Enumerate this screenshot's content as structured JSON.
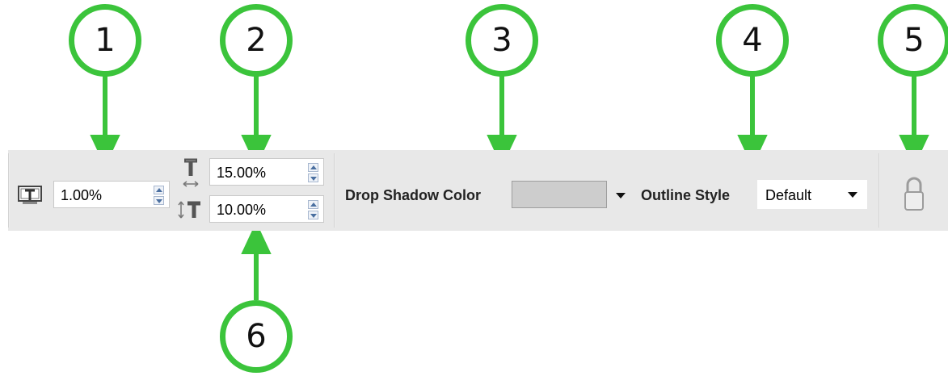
{
  "callouts": [
    "1",
    "2",
    "3",
    "4",
    "5",
    "6"
  ],
  "toolbar": {
    "first_field": {
      "value": "1.00%"
    },
    "second_field_top": {
      "value": "15.00%"
    },
    "second_field_bottom": {
      "value": "10.00%"
    },
    "drop_shadow": {
      "label": "Drop Shadow Color",
      "color": "#cdcdcd"
    },
    "outline_style": {
      "label": "Outline Style",
      "value": "Default"
    }
  },
  "colors": {
    "callout": "#3bc43b",
    "toolbar_bg": "#e8e8e8"
  },
  "icons": [
    "text-frame-icon",
    "letter-spacing-icon",
    "line-spacing-icon",
    "lock-icon",
    "dropdown-arrow-icon"
  ]
}
